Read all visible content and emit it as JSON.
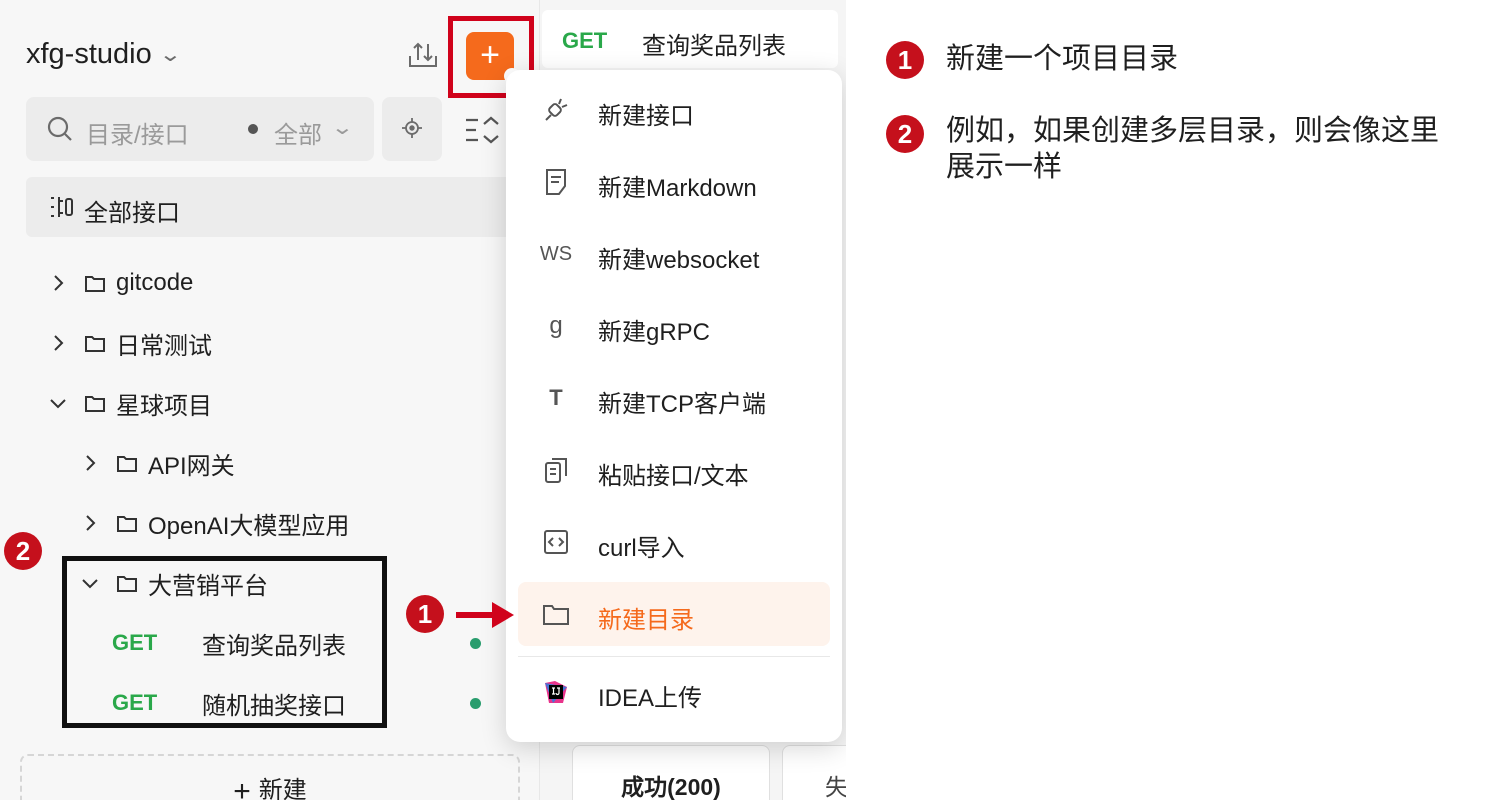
{
  "sidebar": {
    "project_title": "xfg-studio",
    "search_placeholder": "目录/接口",
    "filter_label": "全部",
    "all_api_label": "全部接口",
    "tree": [
      {
        "label": "gitcode",
        "expanded": false
      },
      {
        "label": "日常测试",
        "expanded": false
      },
      {
        "label": "星球项目",
        "expanded": true
      },
      {
        "label": "API网关",
        "expanded": false
      },
      {
        "label": "OpenAI大模型应用",
        "expanded": false
      },
      {
        "label": "大营销平台",
        "expanded": true
      }
    ],
    "endpoints": [
      {
        "method": "GET",
        "name": "查询奖品列表"
      },
      {
        "method": "GET",
        "name": "随机抽奖接口"
      }
    ],
    "new_button_label": "新建",
    "new_button_icon": "plus-icon"
  },
  "main": {
    "tab": {
      "method": "GET",
      "name": "查询奖品列表"
    },
    "response_tab": "成功(200)",
    "response_tab2": "失"
  },
  "menu": {
    "items": [
      {
        "label": "新建接口",
        "icon": "plug-icon"
      },
      {
        "label": "新建Markdown",
        "icon": "document-edit-icon"
      },
      {
        "label": "新建websocket",
        "icon": "ws-icon"
      },
      {
        "label": "新建gRPC",
        "icon": "grpc-icon"
      },
      {
        "label": "新建TCP客户端",
        "icon": "tcp-icon"
      },
      {
        "label": "粘贴接口/文本",
        "icon": "paste-icon"
      },
      {
        "label": "curl导入",
        "icon": "code-icon"
      },
      {
        "label": "新建目录",
        "icon": "folder-icon",
        "active": true
      },
      {
        "label": "IDEA上传",
        "icon": "intellij-icon"
      }
    ]
  },
  "annotations": {
    "badge1": "1",
    "badge2": "2",
    "note1": "新建一个项目目录",
    "note2": "例如，如果创建多层目录，则会像这里展示一样"
  },
  "colors": {
    "accent": "#f56a1c",
    "get_method": "#2aa84a",
    "annotation_red": "#c5101c",
    "highlight_box": "#d0021b"
  }
}
